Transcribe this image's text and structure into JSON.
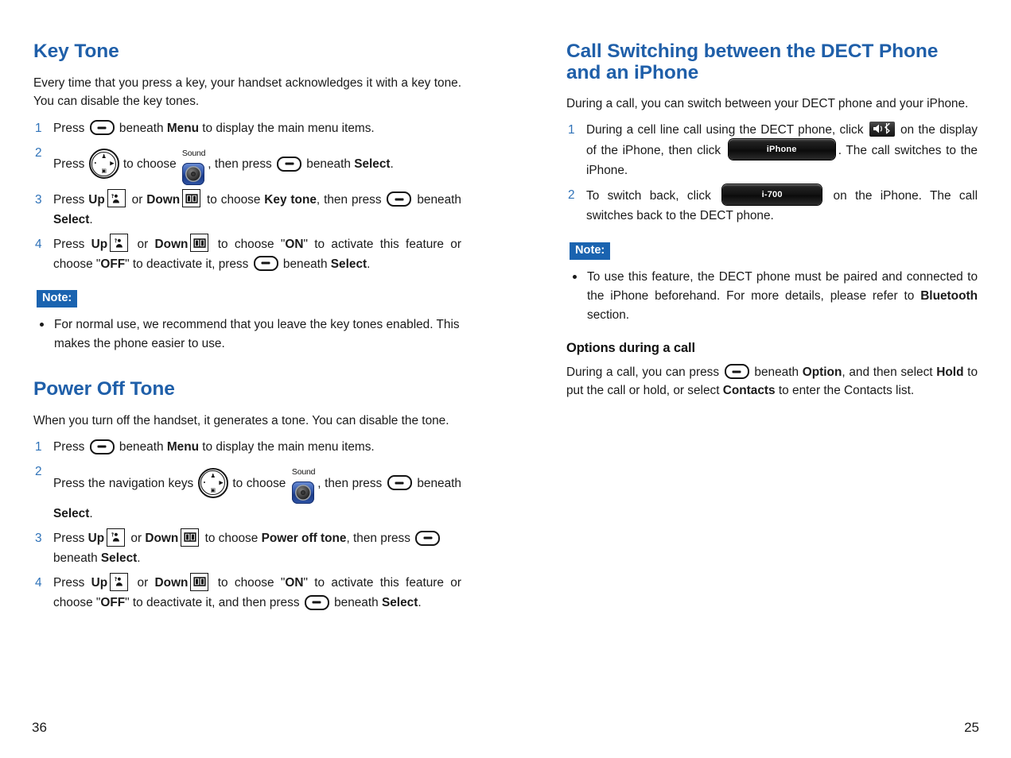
{
  "left_page": {
    "page_number": "36",
    "sections": [
      {
        "id": "key_tone",
        "title": "Key Tone",
        "intro": "Every time that you press a key, your handset acknowledges it with a key tone. You can disable the key tones.",
        "steps": [
          {
            "parts": [
              {
                "t": "text",
                "v": "Press "
              },
              {
                "t": "icon",
                "v": "softkey-icon"
              },
              {
                "t": "text",
                "v": " beneath "
              },
              {
                "t": "bold",
                "v": "Menu"
              },
              {
                "t": "text",
                "v": " to display the main menu items."
              }
            ]
          },
          {
            "parts": [
              {
                "t": "text",
                "v": "Press "
              },
              {
                "t": "icon",
                "v": "navigation-key-icon"
              },
              {
                "t": "text",
                "v": " to choose "
              },
              {
                "t": "icon",
                "v": "sound-menu-icon"
              },
              {
                "t": "text",
                "v": ", then press "
              },
              {
                "t": "icon",
                "v": "softkey-icon"
              },
              {
                "t": "text",
                "v": " beneath "
              },
              {
                "t": "bold",
                "v": "Select"
              },
              {
                "t": "text",
                "v": "."
              }
            ]
          },
          {
            "parts": [
              {
                "t": "text",
                "v": "Press "
              },
              {
                "t": "bold",
                "v": "Up"
              },
              {
                "t": "icon",
                "v": "up-key-icon"
              },
              {
                "t": "text",
                "v": " or "
              },
              {
                "t": "bold",
                "v": "Down"
              },
              {
                "t": "icon",
                "v": "down-key-icon"
              },
              {
                "t": "text",
                "v": " to choose "
              },
              {
                "t": "bold",
                "v": "Key tone"
              },
              {
                "t": "text",
                "v": ", then press "
              },
              {
                "t": "icon",
                "v": "softkey-icon"
              },
              {
                "t": "text",
                "v": " beneath "
              },
              {
                "t": "bold",
                "v": "Select"
              },
              {
                "t": "text",
                "v": "."
              }
            ]
          },
          {
            "parts": [
              {
                "t": "text",
                "v": "Press "
              },
              {
                "t": "bold",
                "v": "Up"
              },
              {
                "t": "icon",
                "v": "up-key-icon"
              },
              {
                "t": "text",
                "v": " or "
              },
              {
                "t": "bold",
                "v": "Down"
              },
              {
                "t": "icon",
                "v": "down-key-icon"
              },
              {
                "t": "text",
                "v": " to choose \""
              },
              {
                "t": "bold",
                "v": "ON"
              },
              {
                "t": "text",
                "v": "\" to activate this feature or choose \""
              },
              {
                "t": "bold",
                "v": "OFF"
              },
              {
                "t": "text",
                "v": "\" to deactivate it, press "
              },
              {
                "t": "icon",
                "v": "softkey-icon"
              },
              {
                "t": "text",
                "v": " beneath "
              },
              {
                "t": "bold",
                "v": "Select"
              },
              {
                "t": "text",
                "v": "."
              }
            ]
          }
        ],
        "note_label": "Note:",
        "notes": [
          {
            "parts": [
              {
                "t": "text",
                "v": "For normal use, we recommend that you leave the key tones enabled. This makes the phone easier to use."
              }
            ]
          }
        ]
      },
      {
        "id": "power_off_tone",
        "title": "Power Off Tone",
        "intro": "When you turn off the handset, it generates a tone. You can disable the tone.",
        "steps": [
          {
            "parts": [
              {
                "t": "text",
                "v": "Press "
              },
              {
                "t": "icon",
                "v": "softkey-icon"
              },
              {
                "t": "text",
                "v": " beneath "
              },
              {
                "t": "bold",
                "v": "Menu"
              },
              {
                "t": "text",
                "v": " to display the main menu items."
              }
            ]
          },
          {
            "parts": [
              {
                "t": "text",
                "v": "Press the navigation keys "
              },
              {
                "t": "icon",
                "v": "navigation-key-icon"
              },
              {
                "t": "text",
                "v": " to choose "
              },
              {
                "t": "icon",
                "v": "sound-menu-icon"
              },
              {
                "t": "text",
                "v": ", then press "
              },
              {
                "t": "icon",
                "v": "softkey-icon"
              },
              {
                "t": "text",
                "v": " beneath "
              },
              {
                "t": "bold",
                "v": "Select"
              },
              {
                "t": "text",
                "v": "."
              }
            ]
          },
          {
            "parts": [
              {
                "t": "text",
                "v": "Press "
              },
              {
                "t": "bold",
                "v": "Up"
              },
              {
                "t": "icon",
                "v": "up-key-icon"
              },
              {
                "t": "text",
                "v": " or "
              },
              {
                "t": "bold",
                "v": "Down"
              },
              {
                "t": "icon",
                "v": "down-key-icon"
              },
              {
                "t": "text",
                "v": " to choose "
              },
              {
                "t": "bold",
                "v": "Power off tone"
              },
              {
                "t": "text",
                "v": ", then press "
              },
              {
                "t": "icon",
                "v": "softkey-icon"
              },
              {
                "t": "text",
                "v": " beneath "
              },
              {
                "t": "bold",
                "v": "Select"
              },
              {
                "t": "text",
                "v": "."
              }
            ]
          },
          {
            "parts": [
              {
                "t": "text",
                "v": "Press "
              },
              {
                "t": "bold",
                "v": "Up"
              },
              {
                "t": "icon",
                "v": "up-key-icon"
              },
              {
                "t": "text",
                "v": " or "
              },
              {
                "t": "bold",
                "v": "Down"
              },
              {
                "t": "icon",
                "v": "down-key-icon"
              },
              {
                "t": "text",
                "v": " to choose \""
              },
              {
                "t": "bold",
                "v": "ON"
              },
              {
                "t": "text",
                "v": "\" to activate this feature or choose \""
              },
              {
                "t": "bold",
                "v": "OFF"
              },
              {
                "t": "text",
                "v": "\" to deactivate it, and then press "
              },
              {
                "t": "icon",
                "v": "softkey-icon"
              },
              {
                "t": "text",
                "v": " beneath "
              },
              {
                "t": "bold",
                "v": "Select"
              },
              {
                "t": "text",
                "v": "."
              }
            ]
          }
        ]
      }
    ]
  },
  "right_page": {
    "page_number": "25",
    "sections": [
      {
        "id": "call_switching",
        "title": "Call Switching between the DECT Phone and an iPhone",
        "intro": "During a call, you can switch between your DECT phone and your iPhone.",
        "steps": [
          {
            "parts": [
              {
                "t": "text",
                "v": "During a cell line call using the DECT phone, click "
              },
              {
                "t": "icon",
                "v": "speaker-bluetooth-button-icon"
              },
              {
                "t": "text",
                "v": " on the display of the iPhone, then click "
              },
              {
                "t": "icon",
                "v": "iphone-pill-button"
              },
              {
                "t": "text",
                "v": ". The call switches to the iPhone."
              }
            ]
          },
          {
            "parts": [
              {
                "t": "text",
                "v": "To switch back, click "
              },
              {
                "t": "icon",
                "v": "i700-pill-button"
              },
              {
                "t": "text",
                "v": " on the iPhone. The call switches back to the DECT phone."
              }
            ]
          }
        ],
        "note_label": "Note:",
        "notes": [
          {
            "parts": [
              {
                "t": "text",
                "v": "To use this feature, the DECT phone must be paired and connected to the iPhone beforehand. For more details, please refer to "
              },
              {
                "t": "bold",
                "v": "Bluetooth"
              },
              {
                "t": "text",
                "v": " section."
              }
            ]
          }
        ]
      },
      {
        "id": "options_during_call",
        "subtitle": "Options during a call",
        "body": [
          {
            "t": "text",
            "v": "During a call, you can press "
          },
          {
            "t": "icon",
            "v": "softkey-icon"
          },
          {
            "t": "text",
            "v": " beneath "
          },
          {
            "t": "bold",
            "v": "Option"
          },
          {
            "t": "text",
            "v": ", and then select "
          },
          {
            "t": "bold",
            "v": "Hold"
          },
          {
            "t": "text",
            "v": " to put the call or hold, or select "
          },
          {
            "t": "bold",
            "v": "Contacts"
          },
          {
            "t": "text",
            "v": " to enter the Contacts list."
          }
        ]
      }
    ]
  },
  "icon_labels": {
    "sound_caption": "Sound",
    "iphone_button_label": "iPhone",
    "i700_button_label": "i-700"
  },
  "colors": {
    "heading_blue": "#1f5fa9",
    "step_number_blue": "#2f72b8",
    "note_badge_blue": "#1a63b0",
    "text_black": "#1a1a1a"
  }
}
